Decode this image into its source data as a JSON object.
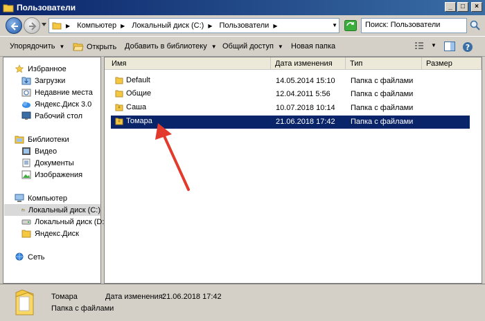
{
  "window": {
    "title": "Пользователи"
  },
  "address": {
    "crumbs": [
      "Компьютер",
      "Локальный диск (C:)",
      "Пользователи"
    ],
    "search_placeholder": "Поиск: Пользователи"
  },
  "toolbar": {
    "organize": "Упорядочить",
    "open": "Открыть",
    "add_to_library": "Добавить в библиотеку",
    "share": "Общий доступ",
    "new_folder": "Новая папка"
  },
  "sidebar": {
    "favorites": "Избранное",
    "downloads": "Загрузки",
    "recent": "Недавние места",
    "yadisk30": "Яндекс.Диск 3.0",
    "desktop": "Рабочий стол",
    "libraries": "Библиотеки",
    "video": "Видео",
    "documents": "Документы",
    "images": "Изображения",
    "computer": "Компьютер",
    "disk_c": "Локальный диск (C:)",
    "disk_d": "Локальный диск (D:)",
    "yadisk": "Яндекс.Диск",
    "network": "Сеть"
  },
  "columns": {
    "name": "Имя",
    "date": "Дата изменения",
    "type": "Тип",
    "size": "Размер"
  },
  "files": [
    {
      "name": "Default",
      "date": "14.05.2014 15:10",
      "type": "Папка с файлами"
    },
    {
      "name": "Общие",
      "date": "12.04.2011 5:56",
      "type": "Папка с файлами"
    },
    {
      "name": "Саша",
      "date": "10.07.2018 10:14",
      "type": "Папка с файлами"
    },
    {
      "name": "Томара",
      "date": "21.06.2018 17:42",
      "type": "Папка с файлами"
    }
  ],
  "details": {
    "name": "Томара",
    "type": "Папка с файлами",
    "date_label": "Дата изменения:",
    "date_value": "21.06.2018 17:42"
  },
  "colors": {
    "selection": "#0a246a",
    "titlebar": "#0a246a",
    "annotation_arrow": "#e23b2e"
  }
}
